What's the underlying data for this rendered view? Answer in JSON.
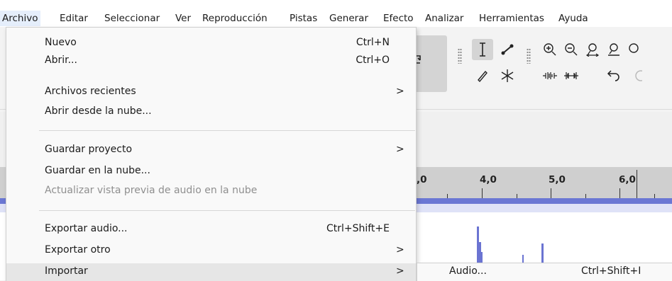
{
  "menubar": {
    "items": [
      {
        "label": "Archivo"
      },
      {
        "label": "Editar"
      },
      {
        "label": "Seleccionar"
      },
      {
        "label": "Ver"
      },
      {
        "label": "Reproducción"
      },
      {
        "label": "Pistas"
      },
      {
        "label": "Generar"
      },
      {
        "label": "Efecto"
      },
      {
        "label": "Analizar"
      },
      {
        "label": "Herramientas"
      },
      {
        "label": "Ayuda"
      }
    ]
  },
  "archivo_menu": {
    "items": [
      {
        "label": "Nuevo",
        "shortcut": "Ctrl+N"
      },
      {
        "label": "Abrir...",
        "shortcut": "Ctrl+O"
      },
      {
        "label": "Archivos recientes",
        "submenu_arrow": ">"
      },
      {
        "label": "Abrir desde la nube..."
      },
      {
        "label": "Guardar proyecto",
        "submenu_arrow": ">"
      },
      {
        "label": "Guardar en la nube..."
      },
      {
        "label": "Actualizar vista previa de audio en la nube",
        "disabled": true
      },
      {
        "label": "Exportar audio...",
        "shortcut": "Ctrl+Shift+E"
      },
      {
        "label": "Exportar otro",
        "submenu_arrow": ">"
      },
      {
        "label": "Importar",
        "submenu_arrow": ">",
        "highlighted": true
      }
    ]
  },
  "importar_submenu": {
    "items": [
      {
        "label": "Audio...",
        "shortcut": "Ctrl+Shift+I"
      }
    ]
  },
  "ruler": {
    "labels": [
      ",0",
      "4,0",
      "5,0",
      "6,0"
    ]
  },
  "toolbar": {
    "icons": [
      "loop-icon",
      "selection-tool-icon",
      "envelope-tool-icon",
      "draw-tool-icon",
      "multi-tool-icon",
      "zoom-in-icon",
      "zoom-out-icon",
      "fit-selection-icon",
      "fit-project-icon",
      "trim-outside-icon",
      "silence-selection-icon",
      "undo-icon"
    ]
  },
  "colors": {
    "menu_bg": "#f9f9f9",
    "highlight": "#e6e6e6",
    "waveform": "#6b74d2",
    "ruler_bg": "#cfcfcf"
  }
}
